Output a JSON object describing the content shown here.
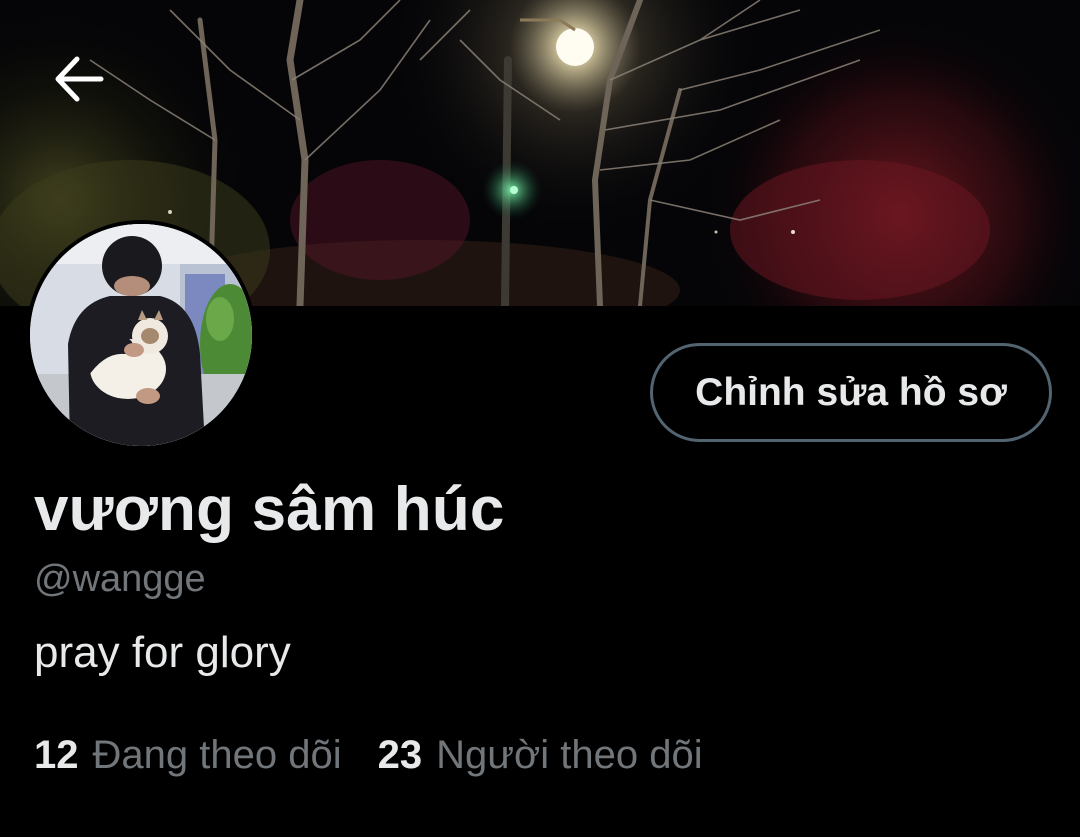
{
  "profile": {
    "display_name": "vương sâm húc",
    "handle": "@wangge",
    "bio": "pray for glory",
    "edit_button_label": "Chỉnh sửa hồ sơ"
  },
  "stats": {
    "following_count": "12",
    "following_label": "Đang theo dõi",
    "followers_count": "23",
    "followers_label": "Người theo dõi"
  },
  "icons": {
    "back": "arrow-left-icon"
  },
  "colors": {
    "background": "#000000",
    "primary_text": "#e7e9ea",
    "secondary_text": "#71767b",
    "button_border": "#536471"
  }
}
